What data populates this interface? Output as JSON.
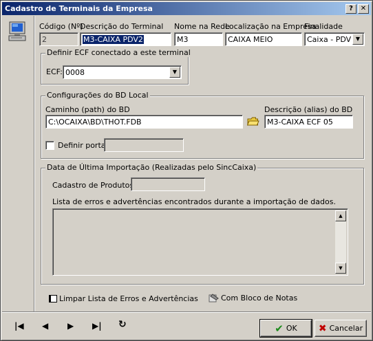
{
  "window": {
    "title": "Cadastro de Terminais da Empresa",
    "help_label": "?",
    "close_label": "✕"
  },
  "header": {
    "codigo_label": "Código (Nº)",
    "codigo_value": "2",
    "descricao_label": "Descrição do Terminal",
    "descricao_value": "M3-CAIXA PDV2",
    "nome_label": "Nome na Rede",
    "nome_value": "M3",
    "localizacao_label": "Localização na Empresa",
    "localizacao_value": "CAIXA MEIO",
    "finalidade_label": "Finalidade",
    "finalidade_value": "Caixa - PDV -"
  },
  "ecf_group": {
    "title": "Definir ECF conectado a este terminal",
    "ecf_label": "ECF:",
    "ecf_value": "0008"
  },
  "bd_group": {
    "title": "Configurações do BD Local",
    "caminho_label": "Caminho (path) do BD",
    "caminho_value": "C:\\OCAIXA\\BD\\THOT.FDB",
    "alias_label": "Descrição (alias) do BD",
    "alias_value": "M3-CAIXA ECF 05",
    "porta_label": "Definir porta:",
    "porta_checked": false,
    "porta_value": ""
  },
  "import_group": {
    "title": "Data de Última Importação (Realizadas pelo SincCaixa)",
    "produtos_label": "Cadastro de Produtos:",
    "produtos_value": "",
    "erros_label": "Lista de erros e advertências encontrados durante a importação de dados.",
    "erros_items": []
  },
  "actions": {
    "limpar_label": "Limpar Lista de Erros e Advertências",
    "bloco_label": "Com Bloco de Notas"
  },
  "nav": {
    "first": "|◀",
    "prev": "◀",
    "next": "▶",
    "last": "▶|",
    "refresh": "↻"
  },
  "footer": {
    "ok_label": "OK",
    "cancel_label": "Cancelar"
  },
  "colors": {
    "titlebar_start": "#0a246a",
    "titlebar_end": "#a6caf0",
    "ok_check": "#1b8a1b",
    "cancel_x": "#c00000"
  }
}
